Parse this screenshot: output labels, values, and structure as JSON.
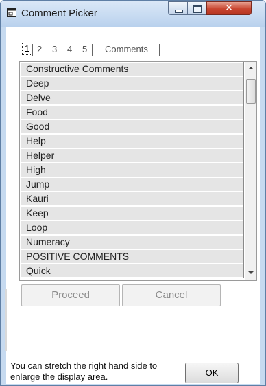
{
  "window": {
    "title": "Comment Picker"
  },
  "tabs": [
    "1",
    "2",
    "3",
    "4",
    "5",
    "Comments"
  ],
  "list": {
    "items": [
      "Constructive Comments",
      "Deep",
      "Delve",
      "Food",
      "Good",
      "Help",
      "Helper",
      "High",
      "Jump",
      "Kauri",
      "Keep",
      "Loop",
      "Numeracy",
      "POSITIVE COMMENTS",
      "Quick"
    ]
  },
  "buttons": {
    "proceed": "Proceed",
    "cancel": "Cancel",
    "ok": "OK"
  },
  "hint": "You can stretch the right hand side to enlarge the display area.",
  "colors": {
    "titlebar": "#c6daf0",
    "close_button": "#c8452f",
    "row_background": "#e5e5e5"
  },
  "icons": {
    "app": "window-icon",
    "minimize": "minimize-icon",
    "maximize": "maximize-icon",
    "close": "close-icon"
  }
}
